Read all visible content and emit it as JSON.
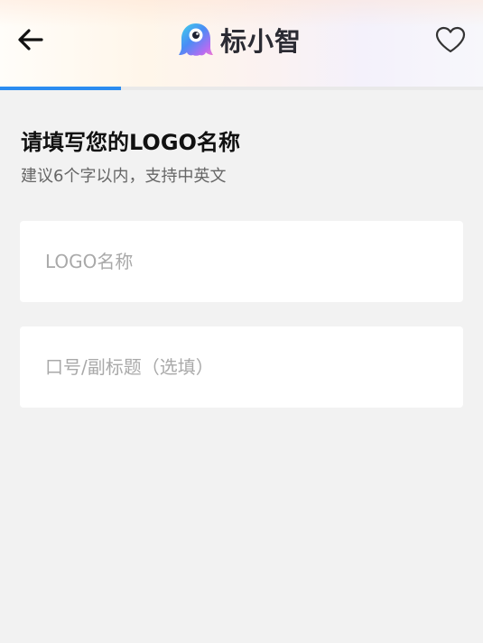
{
  "header": {
    "back_icon": "arrow-left-icon",
    "brand_name": "标小智",
    "brand_logo_icon": "ghost-mascot-logo",
    "favorite_icon": "heart-outline-icon"
  },
  "progress": {
    "value": 0.25,
    "color": "#2b8cf0"
  },
  "main": {
    "title": "请填写您的LOGO名称",
    "subtitle": "建议6个字以内，支持中英文",
    "logo_name_field": {
      "value": "",
      "placeholder": "LOGO名称"
    },
    "slogan_field": {
      "value": "",
      "placeholder": "口号/副标题（选填）"
    }
  },
  "colors": {
    "background": "#f2f2f2",
    "accent": "#2b8cf0",
    "field_background": "#ffffff"
  }
}
